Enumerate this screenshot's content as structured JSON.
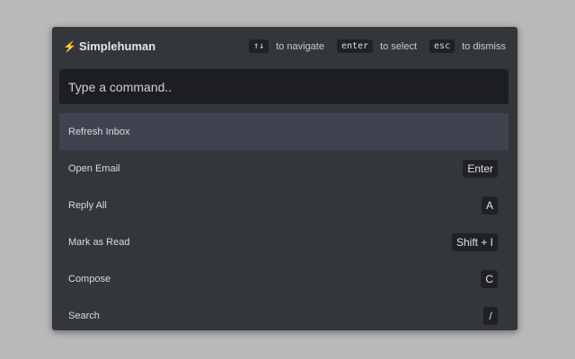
{
  "header": {
    "brand_icon": "lightning-icon",
    "brand_name": "Simplehuman",
    "hints": [
      {
        "key": "↑↓",
        "label": "to navigate"
      },
      {
        "key": "enter",
        "label": "to select"
      },
      {
        "key": "esc",
        "label": "to dismiss"
      }
    ]
  },
  "search": {
    "placeholder": "Type a command..",
    "value": ""
  },
  "commands": [
    {
      "label": "Refresh Inbox",
      "shortcut": "",
      "selected": true
    },
    {
      "label": "Open Email",
      "shortcut": "Enter"
    },
    {
      "label": "Reply All",
      "shortcut": "A"
    },
    {
      "label": "Mark as Read",
      "shortcut": "Shift + I"
    },
    {
      "label": "Compose",
      "shortcut": "C"
    },
    {
      "label": "Search",
      "shortcut": "/"
    }
  ],
  "colors": {
    "background": "#b9b9b9",
    "panel": "#33363b",
    "selected_row": "#40434f",
    "accent_bolt": "#f5c518"
  }
}
